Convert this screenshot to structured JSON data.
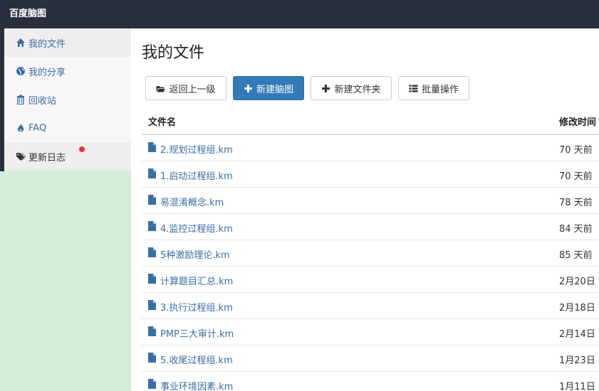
{
  "app": {
    "title": "百度脑图"
  },
  "sidebar": {
    "items": [
      {
        "label": "我的文件",
        "icon": "home-icon"
      },
      {
        "label": "我的分享",
        "icon": "globe-icon"
      },
      {
        "label": "回收站",
        "icon": "trash-icon"
      },
      {
        "label": "FAQ",
        "icon": "fire-icon"
      },
      {
        "label": "更新日志",
        "icon": "tags-icon",
        "has_badge": true
      }
    ]
  },
  "main": {
    "title": "我的文件",
    "toolbar": {
      "back_label": "返回上一级",
      "new_mindmap_label": "新建脑图",
      "new_folder_label": "新建文件夹",
      "batch_label": "批量操作"
    },
    "table": {
      "headers": {
        "name": "文件名",
        "modified": "修改时间"
      },
      "rows": [
        {
          "name": "2.规划过程组.km",
          "modified": "70 天前"
        },
        {
          "name": "1.启动过程组.km",
          "modified": "70 天前"
        },
        {
          "name": "易混淆概念.km",
          "modified": "78 天前"
        },
        {
          "name": "4.监控过程组.km",
          "modified": "84 天前"
        },
        {
          "name": "5种激励理论.km",
          "modified": "85 天前"
        },
        {
          "name": "计算题目汇总.km",
          "modified": "2月20日"
        },
        {
          "name": "3.执行过程组.km",
          "modified": "2月18日"
        },
        {
          "name": "PMP三大审计.km",
          "modified": "2月14日"
        },
        {
          "name": "5.收尾过程组.km",
          "modified": "1月23日"
        },
        {
          "name": "事业环境因素.km",
          "modified": "1月11日"
        }
      ]
    }
  },
  "colors": {
    "topbar": "#2a2f3d",
    "sidebar_bg": "#d5ecd7",
    "link": "#3a6ea5",
    "primary": "#337ab7",
    "badge": "#ee3333"
  }
}
